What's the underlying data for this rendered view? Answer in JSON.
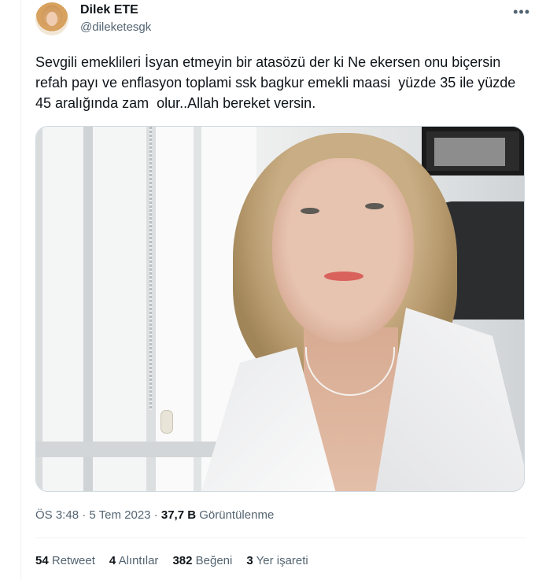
{
  "author": {
    "name": "Dilek ETE",
    "handle": "@dileketesgk"
  },
  "menu_icon": "more-horizontal-icon",
  "tweet": {
    "text": "Sevgili emeklileri İsyan etmeyin bir atasözü der ki Ne ekersen onu biçersin refah payı ve enflasyon toplami ssk bagkur emekli maasi  yüzde 35 ile yüzde 45 aralığında zam  olur..Allah bereket versin."
  },
  "meta": {
    "time": "ÖS 3:48",
    "date": "5 Tem 2023",
    "views_count": "37,7 B",
    "views_label": "Görüntülenme",
    "sep1": " · ",
    "sep2": " · "
  },
  "stats": {
    "retweets_count": "54",
    "retweets_label": "Retweet",
    "quotes_count": "4",
    "quotes_label": "Alıntılar",
    "likes_count": "382",
    "likes_label": "Beğeni",
    "bookmarks_count": "3",
    "bookmarks_label": "Yer işareti"
  },
  "colors": {
    "text": "#0f1419",
    "secondary": "#536471",
    "border": "#cfd9de"
  }
}
